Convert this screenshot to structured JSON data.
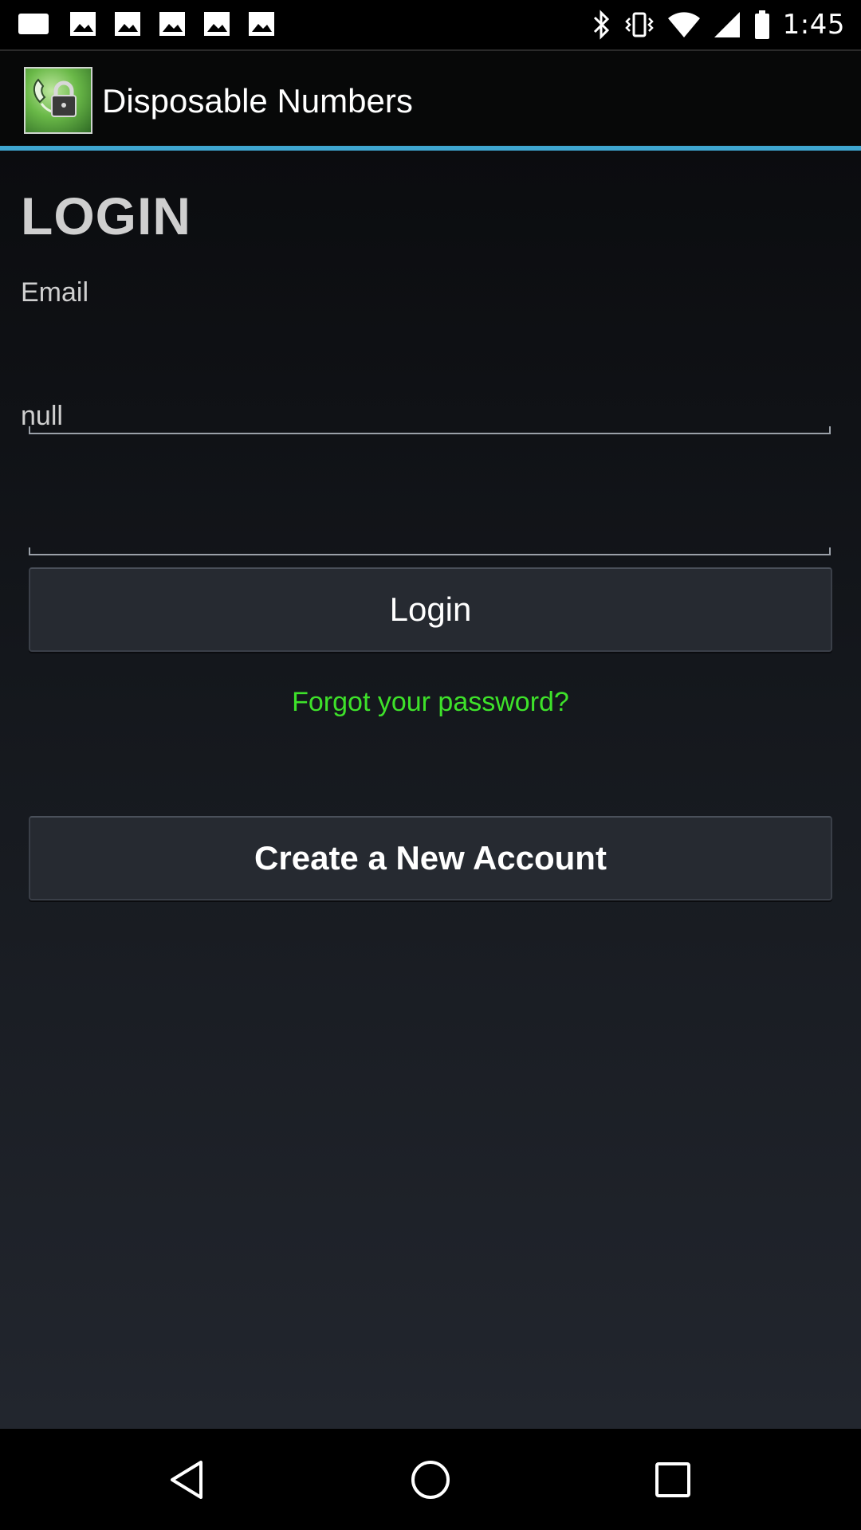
{
  "status_bar": {
    "time": "1:45",
    "left_icons": [
      "gallery-icon",
      "image-icon",
      "image-icon",
      "image-icon",
      "image-icon",
      "image-icon"
    ],
    "right_icons": [
      "bluetooth-icon",
      "vibrate-icon",
      "wifi-icon",
      "signal-icon",
      "battery-icon"
    ]
  },
  "action_bar": {
    "title": "Disposable Numbers",
    "logo_icon": "phone-lock-icon",
    "divider_color": "#3fa6d0"
  },
  "login_form": {
    "heading": "LOGIN",
    "email_label": "Email",
    "email_value": "",
    "password_label": "null",
    "password_value": "",
    "login_button": "Login",
    "forgot_link": "Forgot your password?",
    "create_account_button": "Create a New Account",
    "link_color": "#3ee22a"
  },
  "nav_bar": {
    "back_icon": "back-icon",
    "home_icon": "home-icon",
    "recents_icon": "recents-icon"
  }
}
